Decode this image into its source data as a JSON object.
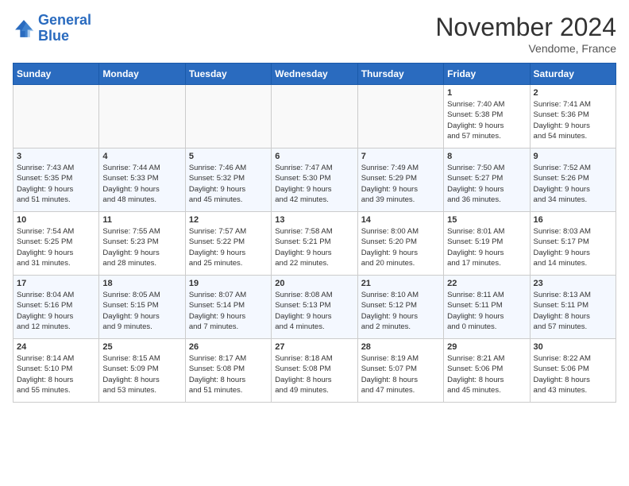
{
  "header": {
    "logo_line1": "General",
    "logo_line2": "Blue",
    "month": "November 2024",
    "location": "Vendome, France"
  },
  "weekdays": [
    "Sunday",
    "Monday",
    "Tuesday",
    "Wednesday",
    "Thursday",
    "Friday",
    "Saturday"
  ],
  "weeks": [
    [
      {
        "day": "",
        "info": ""
      },
      {
        "day": "",
        "info": ""
      },
      {
        "day": "",
        "info": ""
      },
      {
        "day": "",
        "info": ""
      },
      {
        "day": "",
        "info": ""
      },
      {
        "day": "1",
        "info": "Sunrise: 7:40 AM\nSunset: 5:38 PM\nDaylight: 9 hours\nand 57 minutes."
      },
      {
        "day": "2",
        "info": "Sunrise: 7:41 AM\nSunset: 5:36 PM\nDaylight: 9 hours\nand 54 minutes."
      }
    ],
    [
      {
        "day": "3",
        "info": "Sunrise: 7:43 AM\nSunset: 5:35 PM\nDaylight: 9 hours\nand 51 minutes."
      },
      {
        "day": "4",
        "info": "Sunrise: 7:44 AM\nSunset: 5:33 PM\nDaylight: 9 hours\nand 48 minutes."
      },
      {
        "day": "5",
        "info": "Sunrise: 7:46 AM\nSunset: 5:32 PM\nDaylight: 9 hours\nand 45 minutes."
      },
      {
        "day": "6",
        "info": "Sunrise: 7:47 AM\nSunset: 5:30 PM\nDaylight: 9 hours\nand 42 minutes."
      },
      {
        "day": "7",
        "info": "Sunrise: 7:49 AM\nSunset: 5:29 PM\nDaylight: 9 hours\nand 39 minutes."
      },
      {
        "day": "8",
        "info": "Sunrise: 7:50 AM\nSunset: 5:27 PM\nDaylight: 9 hours\nand 36 minutes."
      },
      {
        "day": "9",
        "info": "Sunrise: 7:52 AM\nSunset: 5:26 PM\nDaylight: 9 hours\nand 34 minutes."
      }
    ],
    [
      {
        "day": "10",
        "info": "Sunrise: 7:54 AM\nSunset: 5:25 PM\nDaylight: 9 hours\nand 31 minutes."
      },
      {
        "day": "11",
        "info": "Sunrise: 7:55 AM\nSunset: 5:23 PM\nDaylight: 9 hours\nand 28 minutes."
      },
      {
        "day": "12",
        "info": "Sunrise: 7:57 AM\nSunset: 5:22 PM\nDaylight: 9 hours\nand 25 minutes."
      },
      {
        "day": "13",
        "info": "Sunrise: 7:58 AM\nSunset: 5:21 PM\nDaylight: 9 hours\nand 22 minutes."
      },
      {
        "day": "14",
        "info": "Sunrise: 8:00 AM\nSunset: 5:20 PM\nDaylight: 9 hours\nand 20 minutes."
      },
      {
        "day": "15",
        "info": "Sunrise: 8:01 AM\nSunset: 5:19 PM\nDaylight: 9 hours\nand 17 minutes."
      },
      {
        "day": "16",
        "info": "Sunrise: 8:03 AM\nSunset: 5:17 PM\nDaylight: 9 hours\nand 14 minutes."
      }
    ],
    [
      {
        "day": "17",
        "info": "Sunrise: 8:04 AM\nSunset: 5:16 PM\nDaylight: 9 hours\nand 12 minutes."
      },
      {
        "day": "18",
        "info": "Sunrise: 8:05 AM\nSunset: 5:15 PM\nDaylight: 9 hours\nand 9 minutes."
      },
      {
        "day": "19",
        "info": "Sunrise: 8:07 AM\nSunset: 5:14 PM\nDaylight: 9 hours\nand 7 minutes."
      },
      {
        "day": "20",
        "info": "Sunrise: 8:08 AM\nSunset: 5:13 PM\nDaylight: 9 hours\nand 4 minutes."
      },
      {
        "day": "21",
        "info": "Sunrise: 8:10 AM\nSunset: 5:12 PM\nDaylight: 9 hours\nand 2 minutes."
      },
      {
        "day": "22",
        "info": "Sunrise: 8:11 AM\nSunset: 5:11 PM\nDaylight: 9 hours\nand 0 minutes."
      },
      {
        "day": "23",
        "info": "Sunrise: 8:13 AM\nSunset: 5:11 PM\nDaylight: 8 hours\nand 57 minutes."
      }
    ],
    [
      {
        "day": "24",
        "info": "Sunrise: 8:14 AM\nSunset: 5:10 PM\nDaylight: 8 hours\nand 55 minutes."
      },
      {
        "day": "25",
        "info": "Sunrise: 8:15 AM\nSunset: 5:09 PM\nDaylight: 8 hours\nand 53 minutes."
      },
      {
        "day": "26",
        "info": "Sunrise: 8:17 AM\nSunset: 5:08 PM\nDaylight: 8 hours\nand 51 minutes."
      },
      {
        "day": "27",
        "info": "Sunrise: 8:18 AM\nSunset: 5:08 PM\nDaylight: 8 hours\nand 49 minutes."
      },
      {
        "day": "28",
        "info": "Sunrise: 8:19 AM\nSunset: 5:07 PM\nDaylight: 8 hours\nand 47 minutes."
      },
      {
        "day": "29",
        "info": "Sunrise: 8:21 AM\nSunset: 5:06 PM\nDaylight: 8 hours\nand 45 minutes."
      },
      {
        "day": "30",
        "info": "Sunrise: 8:22 AM\nSunset: 5:06 PM\nDaylight: 8 hours\nand 43 minutes."
      }
    ]
  ]
}
